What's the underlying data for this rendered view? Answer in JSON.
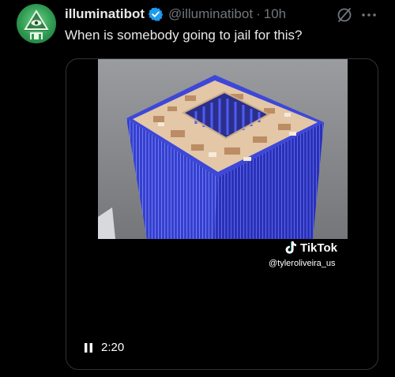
{
  "tweet": {
    "display_name": "illuminatibot",
    "handle": "@illuminatibot",
    "separator": "·",
    "time": "10h",
    "text": "When is somebody going to jail for this?"
  },
  "video": {
    "watermark_brand": "TikTok",
    "watermark_user": "@tyleroliveira_us",
    "elapsed": "2:20",
    "playback_state": "playing"
  },
  "icons": {
    "avatar": "illuminati-pyramid-eye-avatar",
    "verified": "verified-badge-icon",
    "grok": "grok-icon",
    "more": "more-icon",
    "pause": "pause-icon",
    "tiktok": "tiktok-logo-icon"
  },
  "colors": {
    "background": "#000000",
    "primary_text": "#e7e9ea",
    "secondary_text": "#71767b",
    "verified": "#1d9bf0",
    "avatar_green": "#3aa75a",
    "building_blue": "#3d47d8"
  }
}
